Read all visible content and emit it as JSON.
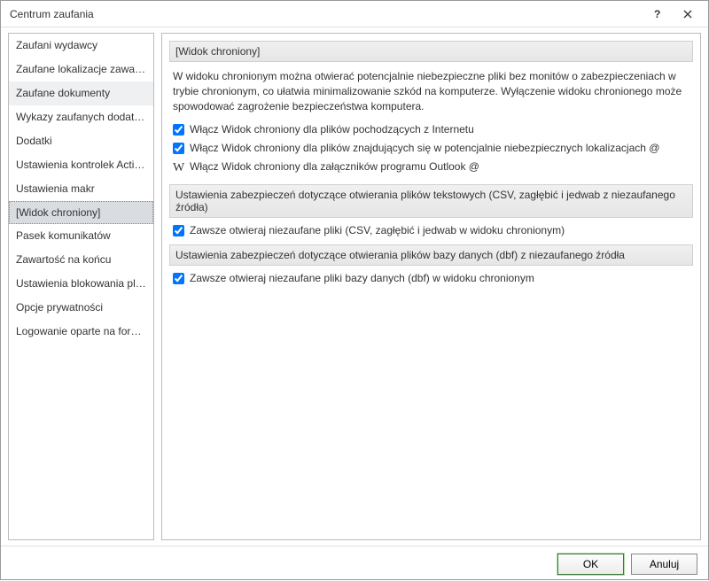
{
  "window": {
    "title": "Centrum zaufania"
  },
  "sidebar": {
    "items": [
      {
        "label": "Zaufani wydawcy"
      },
      {
        "label": "Zaufane lokalizacje zawartości"
      },
      {
        "label": "Zaufane dokumenty"
      },
      {
        "label": "Wykazy zaufanych dodatków"
      },
      {
        "label": "Dodatki"
      },
      {
        "label": "Ustawienia kontrolek ActiveX"
      },
      {
        "label": "Ustawienia makr"
      },
      {
        "label": "[Widok chroniony]"
      },
      {
        "label": "Pasek komunikatów"
      },
      {
        "label": "Zawartość na końcu"
      },
      {
        "label": "Ustawienia blokowania plików"
      },
      {
        "label": "Opcje prywatności"
      },
      {
        "label": "Logowanie oparte na formularzu"
      }
    ]
  },
  "main": {
    "section1": {
      "header": "[Widok chroniony]",
      "description": "W widoku chronionym można otwierać potencjalnie niebezpieczne pliki bez monitów o zabezpieczeniach w trybie chronionym, co ułatwia minimalizowanie szkód na komputerze. Wyłączenie widoku chronionego może spowodować zagrożenie bezpieczeństwa komputera.",
      "checkbox1": "Włącz Widok chroniony dla plików pochodzących z Internetu",
      "checkbox2": "Włącz Widok chroniony dla plików znajdujących się w potencjalnie niebezpiecznych lokalizacjach @",
      "checkbox3_prefix": "W",
      "checkbox3": "Włącz Widok chroniony dla załączników programu Outlook @"
    },
    "section2": {
      "header": "Ustawienia zabezpieczeń dotyczące otwierania plików tekstowych (CSV, zagłębić i jedwab z niezaufanego źródła)",
      "checkbox1": "Zawsze otwieraj niezaufane pliki (CSV, zagłębić i jedwab w widoku chronionym)"
    },
    "section3": {
      "header": "Ustawienia zabezpieczeń dotyczące otwierania plików bazy danych (dbf) z niezaufanego źródła",
      "checkbox1": "Zawsze otwieraj niezaufane pliki bazy danych (dbf) w widoku chronionym"
    }
  },
  "footer": {
    "ok": "OK",
    "cancel": "Anuluj"
  }
}
